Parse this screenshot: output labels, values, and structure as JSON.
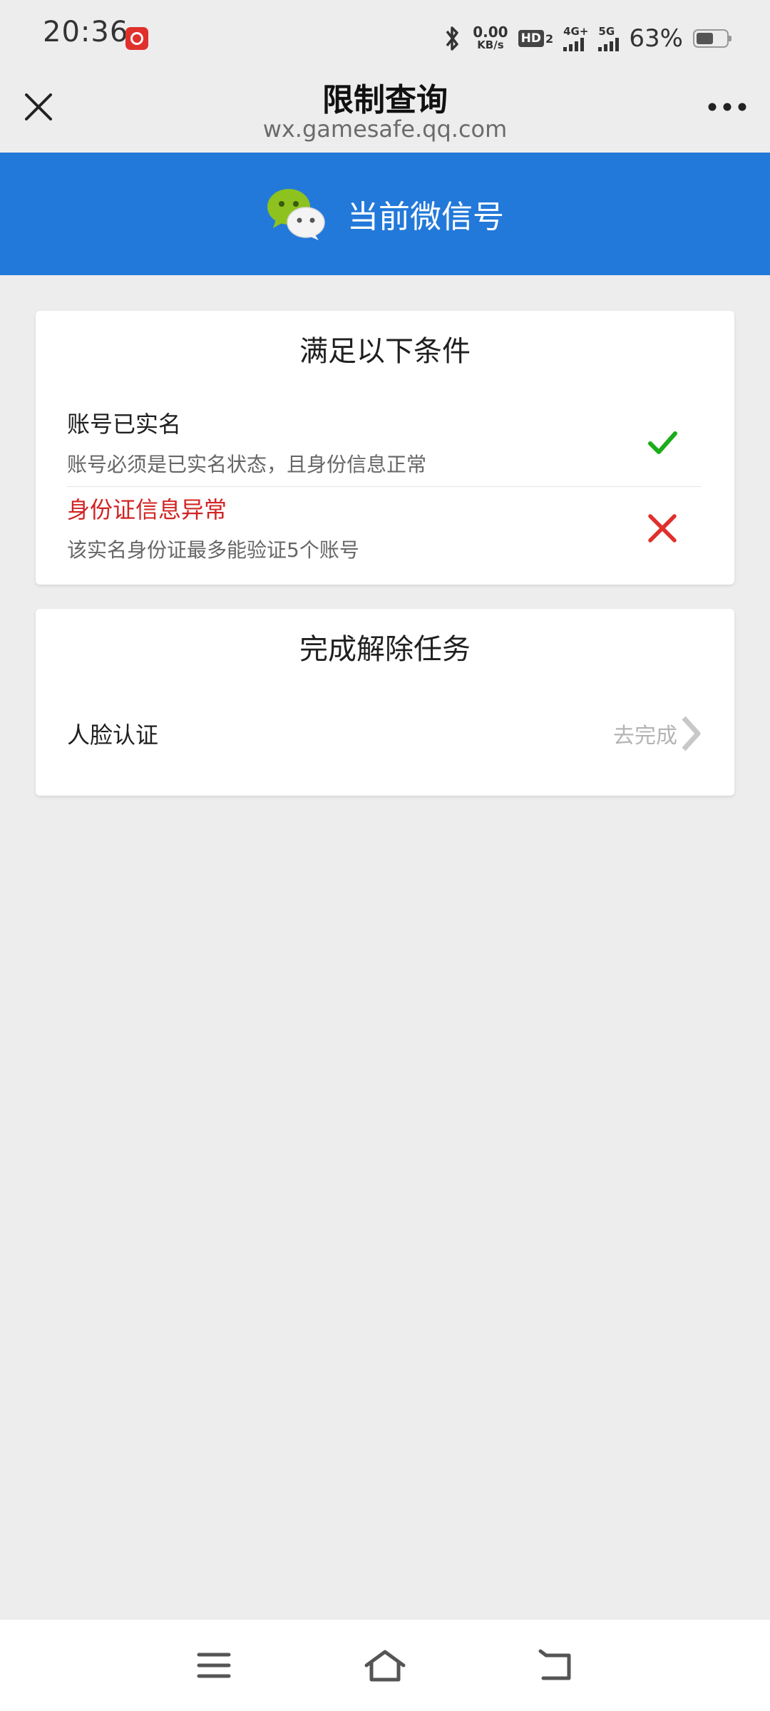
{
  "status_bar": {
    "time": "20:36",
    "net_speed_value": "0.00",
    "net_speed_unit": "KB/s",
    "hd_label": "HD",
    "hd_sub": "2",
    "signal_1_tag": "4G+",
    "signal_2_tag": "5G",
    "battery_percent": "63%",
    "battery_level": 0.63,
    "app_icon": "netease-music-icon"
  },
  "nav": {
    "title": "限制查询",
    "url": "wx.gamesafe.qq.com",
    "close_icon": "close-icon",
    "more_icon": "more-icon"
  },
  "banner": {
    "text": "当前微信号",
    "logo": "wechat-logo",
    "color": "#2379d9"
  },
  "conditions": {
    "title": "满足以下条件",
    "items": [
      {
        "name": "账号已实名",
        "desc": "账号必须是已实名状态，且身份信息正常",
        "status": "pass",
        "icon": "check-icon"
      },
      {
        "name": "身份证信息异常",
        "desc": "该实名身份证最多能验证5个账号",
        "status": "fail",
        "icon": "cross-icon"
      }
    ]
  },
  "tasks": {
    "title": "完成解除任务",
    "items": [
      {
        "name": "人脸认证",
        "action": "去完成"
      }
    ]
  },
  "colors": {
    "background": "#ededed",
    "success": "#1aad19",
    "error": "#d22424",
    "muted": "#b4b4b4"
  },
  "bottom_nav": [
    "menu-icon",
    "home-icon",
    "back-icon"
  ]
}
